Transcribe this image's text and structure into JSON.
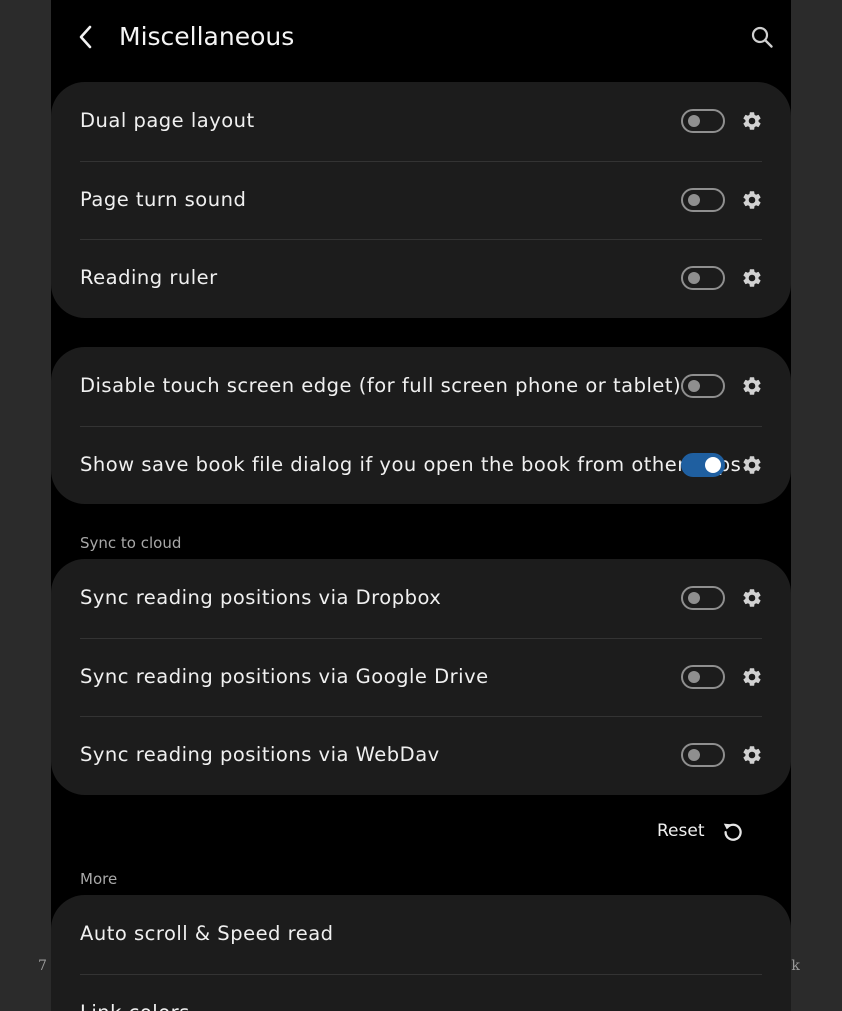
{
  "header": {
    "title": "Miscellaneous"
  },
  "card1": {
    "items": [
      {
        "label": "Dual page layout",
        "on": false
      },
      {
        "label": "Page turn sound",
        "on": false
      },
      {
        "label": "Reading ruler",
        "on": false
      }
    ]
  },
  "card2": {
    "items": [
      {
        "label": "Disable touch screen edge (for full screen phone or tablet)",
        "on": false
      },
      {
        "label": "Show save book file dialog if you open the book from other apps",
        "on": true
      }
    ]
  },
  "sync": {
    "section_label": "Sync to cloud",
    "items": [
      {
        "label": "Sync reading positions via Dropbox",
        "on": false
      },
      {
        "label": "Sync reading positions via Google Drive",
        "on": false
      },
      {
        "label": "Sync reading positions via WebDav",
        "on": false
      }
    ]
  },
  "reset": {
    "label": "Reset"
  },
  "more": {
    "section_label": "More",
    "items": [
      {
        "label": "Auto scroll & Speed read"
      },
      {
        "label": "Link colors"
      }
    ]
  },
  "background": {
    "left_text": "7",
    "right_text": "ok"
  },
  "colors": {
    "accent": "#1f5fa0",
    "card": "#1c1c1c",
    "screen": "#000000"
  }
}
